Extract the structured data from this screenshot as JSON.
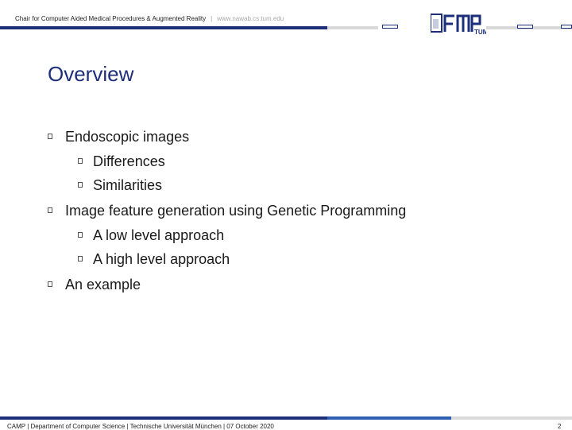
{
  "header": {
    "chair": "Chair for Computer Aided Medical Procedures & Augmented Reality",
    "separator": "|",
    "url": "www.nawab.cs.tum.edu"
  },
  "slide": {
    "title": "Overview",
    "bullets": [
      {
        "text": "Endoscopic images",
        "level": 1
      },
      {
        "text": "Differences",
        "level": 2
      },
      {
        "text": "Similarities",
        "level": 2
      },
      {
        "text": "Image feature generation using Genetic Programming",
        "level": 1
      },
      {
        "text": "A low level approach",
        "level": 2
      },
      {
        "text": "A high level approach",
        "level": 2
      },
      {
        "text": "An example",
        "level": 1
      }
    ]
  },
  "footer": {
    "text": "CAMP | Department of Computer Science | Technische Universität München | 07 October 2020",
    "page": "2"
  },
  "colors": {
    "navy": "#1d2f7a",
    "gray_bar": "#d9d9d9",
    "blue_bar": "#2f5fb0"
  }
}
